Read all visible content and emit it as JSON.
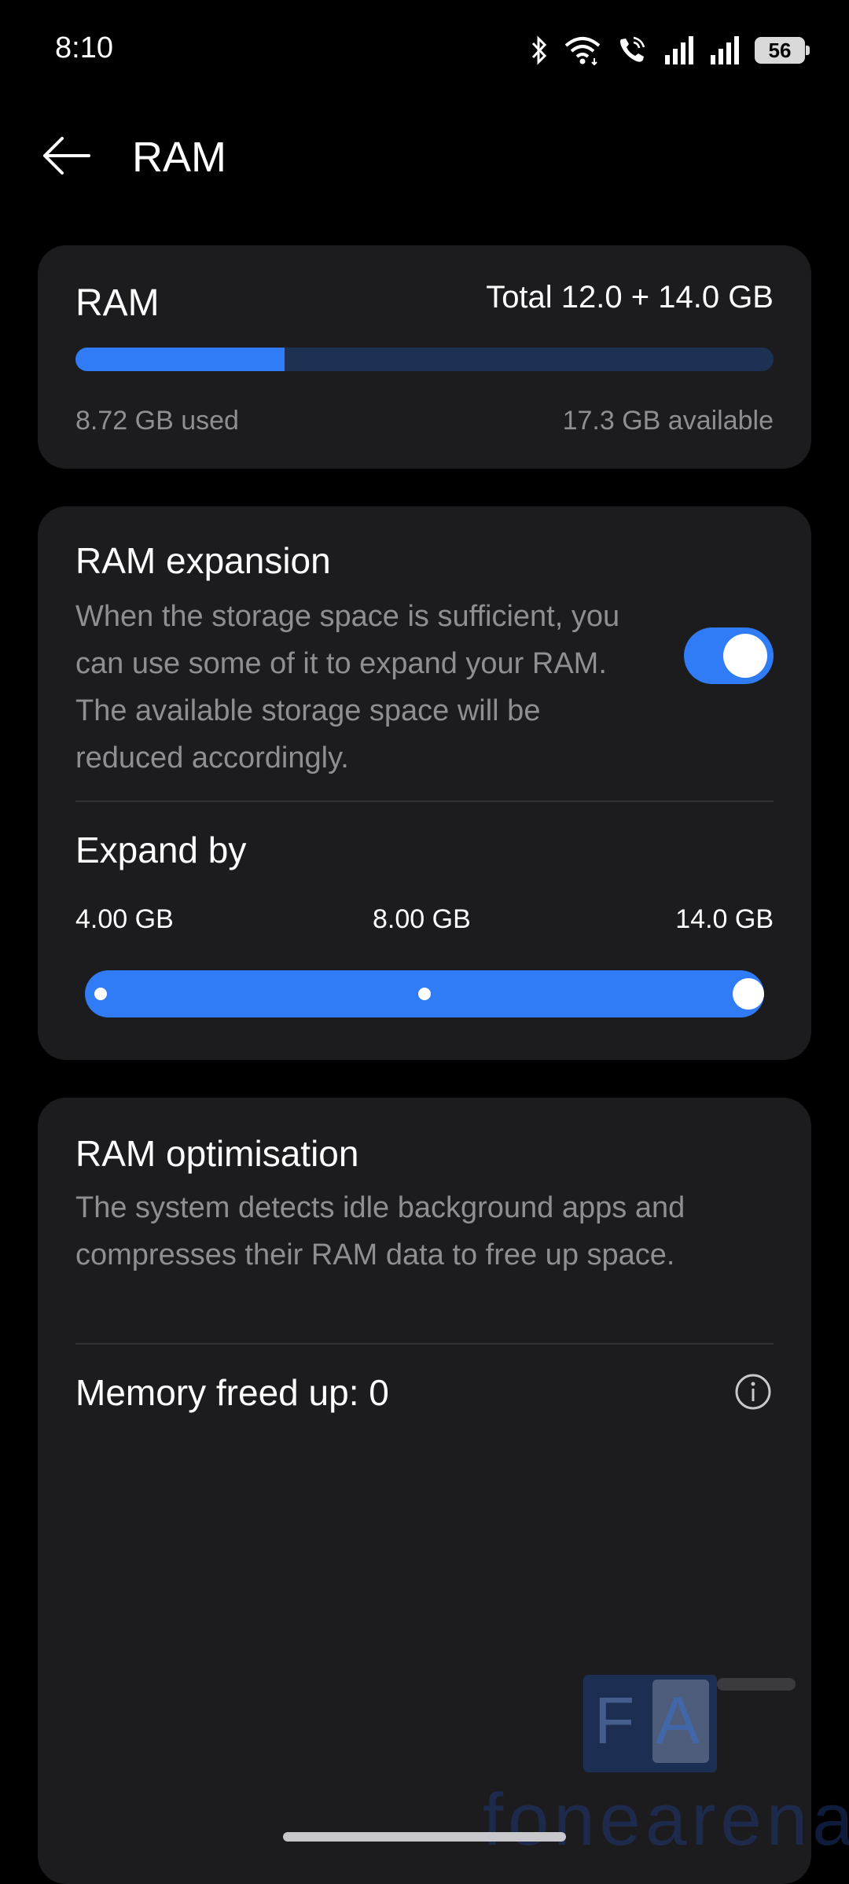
{
  "status_bar": {
    "time": "8:10",
    "battery": "56",
    "icons": [
      "bluetooth-icon",
      "wifi-icon",
      "call-sim2-icon",
      "signal-sim1-icon",
      "signal-sim2-icon",
      "battery-icon"
    ]
  },
  "header": {
    "back_icon": "back-arrow-icon",
    "title": "RAM"
  },
  "ram_card": {
    "label": "RAM",
    "total": "Total 12.0 + 14.0 GB",
    "used_fraction": 0.3,
    "used": "8.72 GB used",
    "available": "17.3 GB available"
  },
  "expansion_card": {
    "title": "RAM expansion",
    "description": "When the storage space is sufficient, you can use some of it to expand your RAM. The available storage space will be reduced accordingly.",
    "toggle_on": true,
    "expand_label": "Expand by",
    "options": [
      "4.00 GB",
      "8.00 GB",
      "14.0 GB"
    ],
    "selected_index": 2
  },
  "optimisation_card": {
    "title": "RAM optimisation",
    "description": "The system detects idle background apps and compresses their RAM data to free up space.",
    "memory_freed": "Memory freed up: 0",
    "info_icon": "info-icon"
  },
  "watermark": {
    "logo_f": "F",
    "logo_a": "A",
    "text": "fonearena"
  },
  "colors": {
    "accent": "#2f7cf6",
    "card": "#1c1c1e",
    "secondary_text": "#8e8e93",
    "background": "#000000"
  }
}
